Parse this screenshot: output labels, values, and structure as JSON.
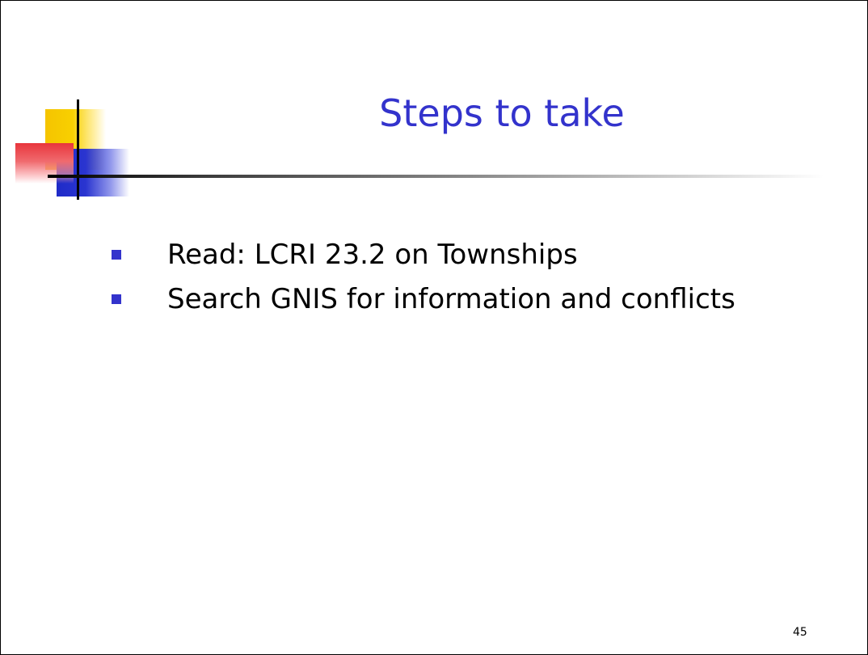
{
  "slide": {
    "title": "Steps to take",
    "bullets": [
      "Read: LCRI 23.2 on Townships",
      "Search GNIS for information and conflicts"
    ],
    "page_number": "45"
  },
  "colors": {
    "title": "#3333cc",
    "bullet_marker": "#3333cc",
    "deco_yellow": "#f5c400",
    "deco_red": "#e8353c",
    "deco_blue": "#1f2bc8"
  }
}
